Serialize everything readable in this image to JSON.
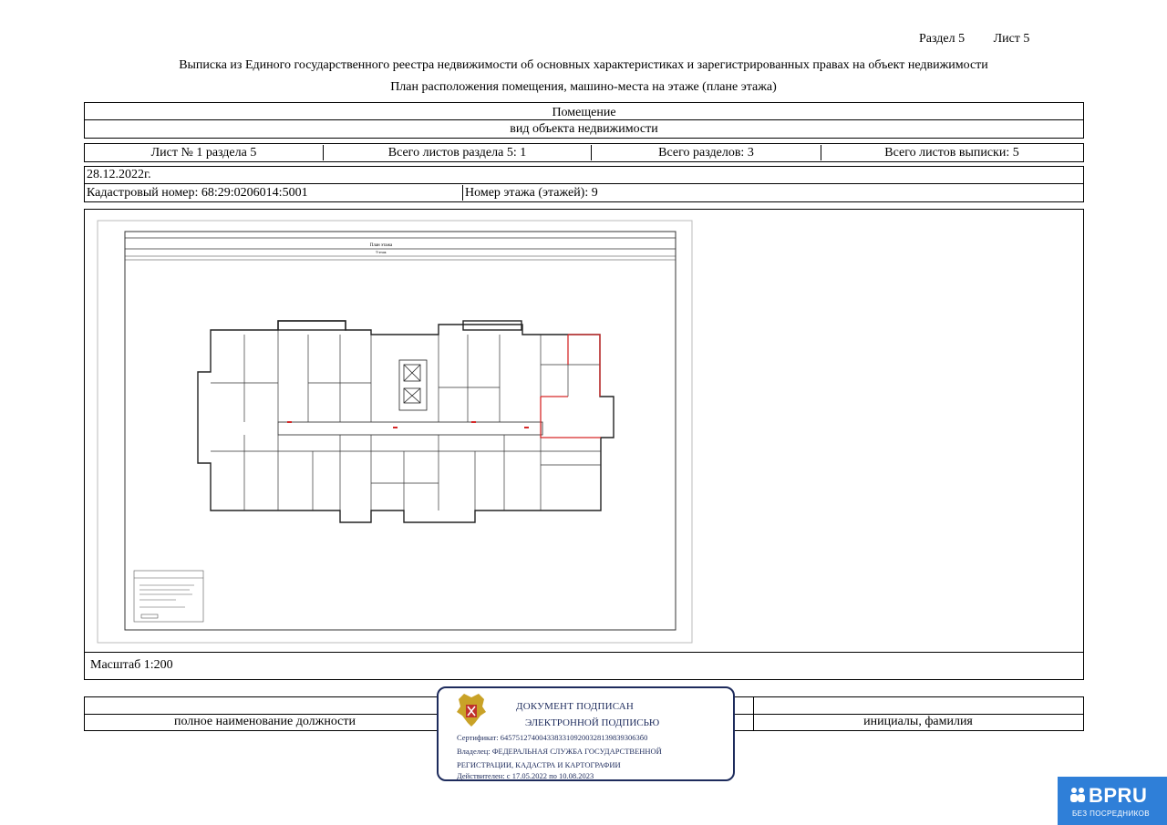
{
  "header": {
    "section": "Раздел 5",
    "sheet": "Лист 5"
  },
  "titles": {
    "main": "Выписка из Единого государственного реестра недвижимости об основных характеристиках и зарегистрированных правах на объект недвижимости",
    "sub": "План расположения помещения, машино-места на этаже (плане этажа)"
  },
  "object": {
    "name": "Помещение",
    "kind_label": "вид объекта недвижимости"
  },
  "sheets": {
    "sheet_no": "Лист № 1 раздела 5",
    "total_section": "Всего листов раздела 5: 1",
    "total_sections": "Всего разделов: 3",
    "total_sheets": "Всего листов выписки: 5"
  },
  "info": {
    "date": "28.12.2022г.",
    "cadastral": "Кадастровый номер: 68:29:0206014:5001",
    "floor": "Номер этажа (этажей): 9"
  },
  "plan": {
    "title": "План этажа",
    "subtitle": "9 этаж"
  },
  "scale": "Масштаб 1:200",
  "signature": {
    "position_label": "полное наименование должности",
    "name_label": "инициалы, фамилия"
  },
  "stamp": {
    "line1": "ДОКУМЕНТ ПОДПИСАН",
    "line2": "ЭЛЕКТРОННОЙ ПОДПИСЬЮ",
    "cert": "Сертификат: 645751274004338331092003281398393063б0",
    "owner1": "Владелец: ФЕДЕРАЛЬНАЯ СЛУЖБА ГОСУДАРСТВЕННОЙ",
    "owner2": "РЕГИСТРАЦИИ, КАДАСТРА И КАРТОГРАФИИ",
    "valid": "Действителен: с 17.05.2022 по 10.08.2023"
  },
  "badge": {
    "logo": "BPRU",
    "tagline": "БЕЗ ПОСРЕДНИКОВ"
  },
  "colors": {
    "stamp": "#1d2b5c",
    "highlight": "#d62828",
    "badge": "#2f7fd8"
  }
}
